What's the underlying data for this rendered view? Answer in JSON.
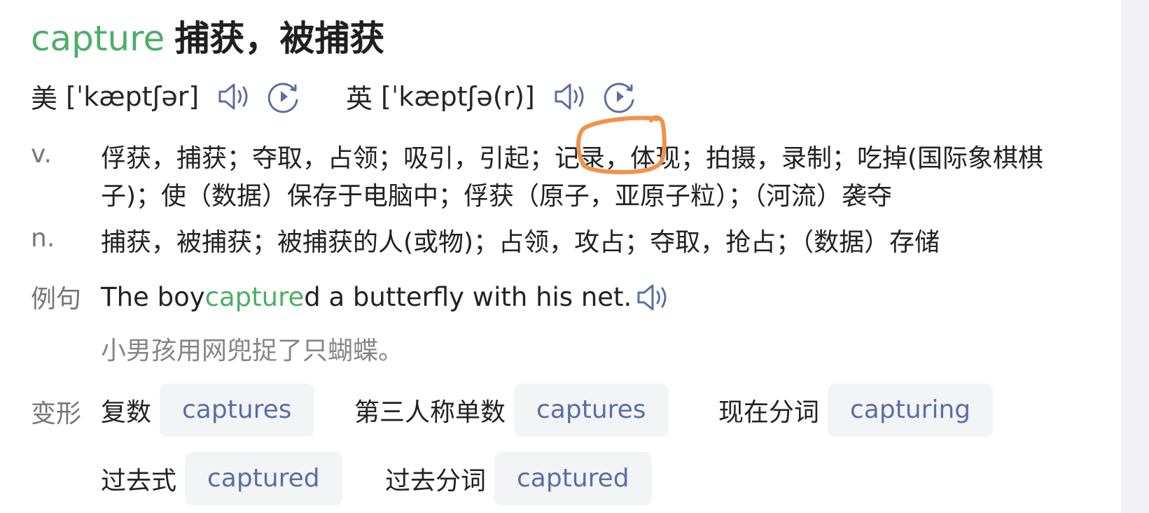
{
  "headword": {
    "word": "capture",
    "gloss": "捕获，被捕获"
  },
  "pronunciations": [
    {
      "accent": "美",
      "ipa": "[ˈkæptʃər]"
    },
    {
      "accent": "英",
      "ipa": "[ˈkæptʃə(r)]"
    }
  ],
  "definitions": [
    {
      "pos": "v.",
      "text": "俘获，捕获；夺取，占领；吸引，引起；记录，体现；拍摄，录制；吃掉(国际象棋棋子)；使（数据）保存于电脑中；俘获（原子，亚原子粒）；（河流）袭夺"
    },
    {
      "pos": "n.",
      "text": "捕获，被捕获；被捕获的人(或物)；占领，攻占；夺取，抢占；（数据）存储"
    }
  ],
  "example": {
    "label": "例句",
    "en_before": "The boy ",
    "en_highlight": "capture",
    "en_after": "d a butterfly with his net.",
    "zh": "小男孩用网兜捉了只蝴蝶。"
  },
  "forms": {
    "label": "变形",
    "items": [
      {
        "name": "复数",
        "value": "captures"
      },
      {
        "name": "第三人称单数",
        "value": "captures"
      },
      {
        "name": "现在分词",
        "value": "capturing"
      },
      {
        "name": "过去式",
        "value": "captured"
      },
      {
        "name": "过去分词",
        "value": "captured"
      }
    ]
  },
  "colors": {
    "accent_green": "#4caf67",
    "chip_text": "#5a6ea3",
    "icon_blue": "#5a6ea3",
    "annotation_orange": "#f0924a"
  },
  "icons": [
    "speaker-icon",
    "replay-icon"
  ]
}
